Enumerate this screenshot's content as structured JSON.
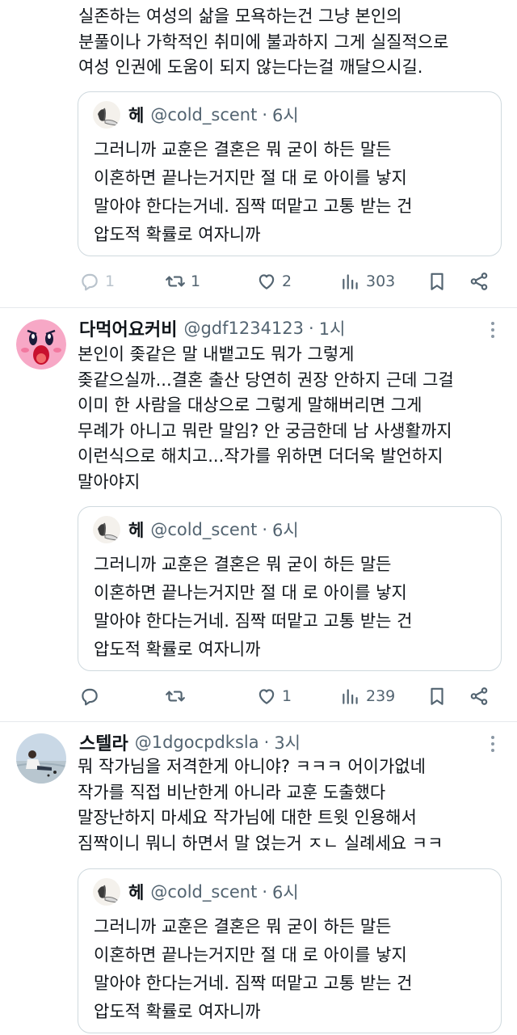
{
  "tweets": [
    {
      "name": "",
      "handle": "",
      "time": "",
      "text": "실존하는 여성의 삶을 모욕하는건 그냥 본인의\n분풀이나 가학적인 취미에 불과하지 그게 실질적으로\n여성 인권에 도움이 되지 않는다는걸 깨달으시길.",
      "quote": {
        "name": "헤",
        "handle": "@cold_scent",
        "dot": "·",
        "time": "6시",
        "text": "그러니까 교훈은 결혼은 뭐 굳이 하든 말든\n이혼하면 끝나는거지만 절 대 로 아이를 낳지\n말아야 한다는거네. 짐짝 떠맡고 고통 받는 건\n압도적 확률로 여자니까"
      },
      "actions": {
        "reply": "1",
        "retweet": "1",
        "like": "2",
        "views": "303"
      }
    },
    {
      "name": "다먹어요커비",
      "handle": "@gdf1234123",
      "dot": "·",
      "time": "1시",
      "avatar_icon": "kirby-avatar",
      "text": "본인이 좆같은 말 내뱉고도 뭐가 그렇게\n좆같으실까...결혼 출산 당연히 권장 안하지 근데 그걸\n이미 한 사람을 대상으로 그렇게 말해버리면 그게\n무례가 아니고 뭐란 말임? 안 궁금한데 남 사생활까지\n이런식으로 해치고...작가를 위하면 더더욱 발언하지\n말아야지",
      "quote": {
        "name": "헤",
        "handle": "@cold_scent",
        "dot": "·",
        "time": "6시",
        "text": "그러니까 교훈은 결혼은 뭐 굳이 하든 말든\n이혼하면 끝나는거지만 절 대 로 아이를 낳지\n말아야 한다는거네. 짐짝 떠맡고 고통 받는 건\n압도적 확률로 여자니까"
      },
      "actions": {
        "reply": "",
        "retweet": "",
        "like": "1",
        "views": "239"
      }
    },
    {
      "name": "스텔라",
      "handle": "@1dgocpdksla",
      "dot": "·",
      "time": "3시",
      "avatar_icon": "person-photo-avatar",
      "text": "뭐 작가님을 저격한게 아니야? ㅋㅋㅋ 어이가없네\n작가를 직접 비난한게 아니라 교훈 도출했다\n말장난하지 마세요 작가님에 대한 트윗 인용해서\n짐짝이니 뭐니 하면서 말 얹는거 ㅈㄴ 실례세요 ㅋㅋ",
      "quote": {
        "name": "헤",
        "handle": "@cold_scent",
        "dot": "·",
        "time": "6시",
        "text": "그러니까 교훈은 결혼은 뭐 굳이 하든 말든\n이혼하면 끝나는거지만 절 대 로 아이를 낳지\n말아야 한다는거네. 짐짝 떠맡고 고통 받는 건\n압도적 확률로 여자니까"
      }
    }
  ],
  "icons": {
    "reply": "reply-icon",
    "retweet": "retweet-icon",
    "like": "like-icon",
    "views": "views-icon",
    "bookmark": "bookmark-icon",
    "share": "share-icon",
    "more": "more-icon"
  },
  "colors": {
    "text": "#0f1419",
    "secondary": "#536471",
    "border": "#cfd9de"
  }
}
